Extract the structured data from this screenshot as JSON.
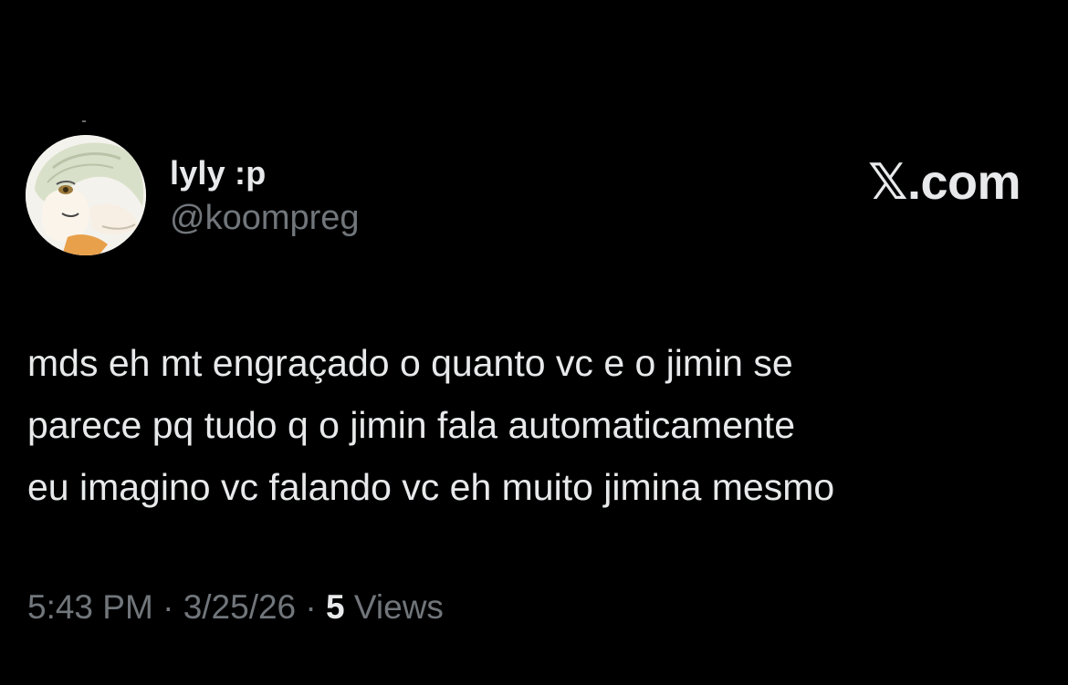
{
  "tweet": {
    "author": {
      "display_name": "lyly :p",
      "handle": "@koompreg",
      "avatar_icon": "anime-character-avatar"
    },
    "brand": {
      "x_glyph": "𝕏",
      "domain": ".com"
    },
    "body_lines": [
      "mds eh mt engraçado o quanto vc e o jimin se",
      "parece pq tudo q o jimin fala automaticamente",
      "eu imagino vc falando vc eh muito jimina mesmo"
    ],
    "meta": {
      "time": "5:43 PM",
      "date": "3/25/26",
      "separator": "·",
      "views_count": "5",
      "views_label": "Views"
    }
  },
  "colors": {
    "background": "#000000",
    "primary_text": "#e7e9ea",
    "secondary_text": "#71767b"
  }
}
